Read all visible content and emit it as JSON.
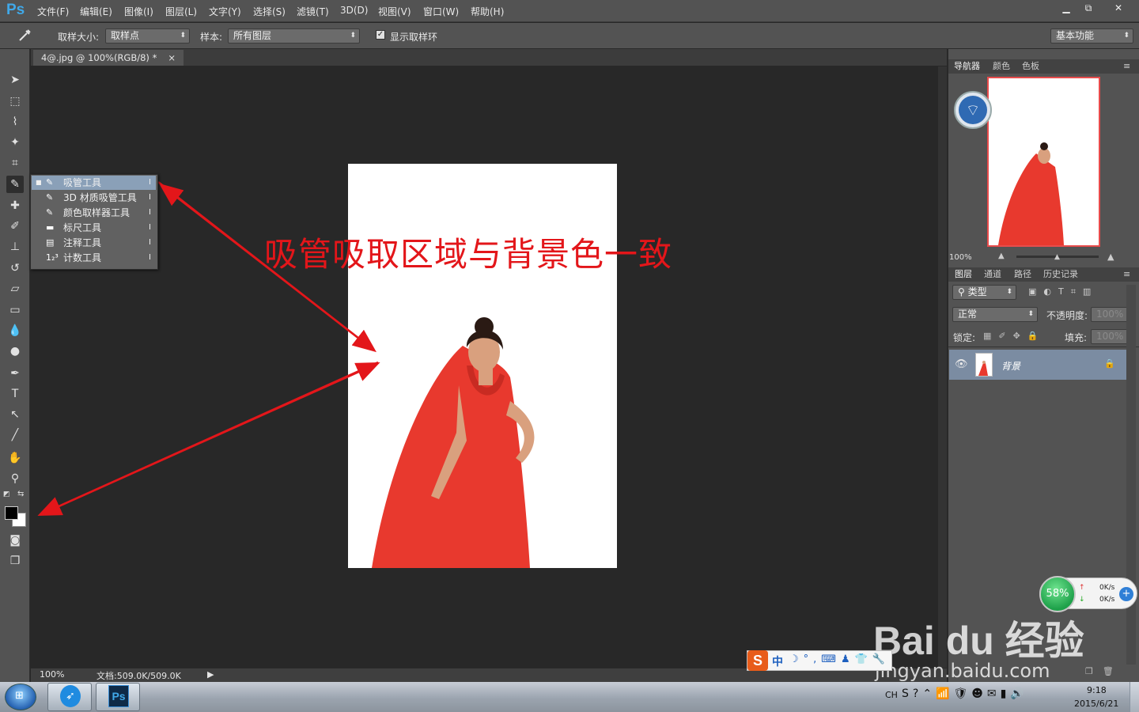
{
  "app": {
    "logo": "Ps",
    "window_buttons": [
      "▁",
      "⧉",
      "✕"
    ]
  },
  "menu": [
    "文件(F)",
    "编辑(E)",
    "图像(I)",
    "图层(L)",
    "文字(Y)",
    "选择(S)",
    "滤镜(T)",
    "3D(D)",
    "视图(V)",
    "窗口(W)",
    "帮助(H)"
  ],
  "options": {
    "sample_size_label": "取样大小:",
    "sample_size_value": "取样点",
    "sample_label": "样本:",
    "sample_value": "所有图层",
    "show_ring_label": "显示取样环",
    "show_ring_checked": true,
    "workspace_value": "基本功能"
  },
  "document": {
    "tab_title": "4@.jpg @ 100%(RGB/8) *",
    "tab_close": "×",
    "annotation": "吸管吸取区域与背景色一致"
  },
  "flyout": [
    {
      "icon": "eyedropper-icon",
      "label": "吸管工具",
      "key": "I",
      "selected": true
    },
    {
      "icon": "3d-eyedropper-icon",
      "label": "3D 材质吸管工具",
      "key": "I",
      "selected": false
    },
    {
      "icon": "color-sampler-icon",
      "label": "颜色取样器工具",
      "key": "I",
      "selected": false
    },
    {
      "icon": "ruler-icon",
      "label": "标尺工具",
      "key": "I",
      "selected": false
    },
    {
      "icon": "note-icon",
      "label": "注释工具",
      "key": "I",
      "selected": false
    },
    {
      "icon": "count-icon",
      "label": "计数工具",
      "key": "I",
      "selected": false
    }
  ],
  "status": {
    "zoom": "100%",
    "doc_info": "文档:509.0K/509.0K"
  },
  "navigator": {
    "tabs": [
      "导航器",
      "颜色",
      "色板"
    ],
    "zoom": "100%"
  },
  "layers": {
    "tabs": [
      "图层",
      "通道",
      "路径",
      "历史记录"
    ],
    "filter_label": "类型",
    "blend_mode": "正常",
    "opacity_label": "不透明度:",
    "opacity_value": "100%",
    "lock_label": "锁定:",
    "fill_label": "填充:",
    "fill_value": "100%",
    "layer_name": "背景"
  },
  "netmeter": {
    "percent": "58%",
    "up": "0K/s",
    "down": "0K/s"
  },
  "ime": {
    "mode": "中"
  },
  "taskbar": {
    "lang": "CH",
    "time": "9:18",
    "date": "2015/6/21"
  },
  "watermark": {
    "brand": "Bai du 经验",
    "url": "jingyan.baidu.com"
  },
  "colors": {
    "annotation_red": "#e3161a",
    "dress_red": "#e8392e",
    "ui_gray": "#535353",
    "canvas_gray": "#282828"
  }
}
